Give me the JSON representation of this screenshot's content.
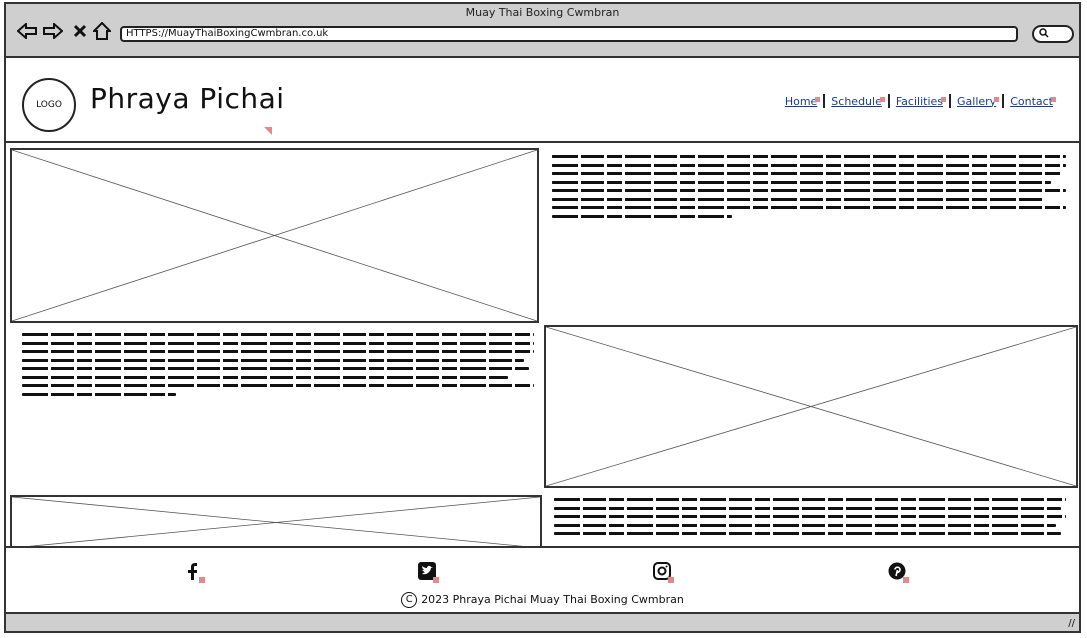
{
  "window": {
    "title": "Muay Thai Boxing Cwmbran"
  },
  "browser": {
    "url": "HTTPS://MuayThaiBoxingCwmbran.co.uk",
    "icons": [
      "back-icon",
      "forward-icon",
      "close-icon",
      "home-icon",
      "search-icon"
    ]
  },
  "header": {
    "logo_text": "LOGO",
    "brand": "Phraya Pichai",
    "nav": [
      {
        "label": "Home"
      },
      {
        "label": "Schedule"
      },
      {
        "label": "Facilities"
      },
      {
        "label": "Gallery"
      },
      {
        "label": "Contact"
      }
    ]
  },
  "footer": {
    "social": [
      "facebook-icon",
      "twitter-icon",
      "instagram-icon",
      "pinterest-icon"
    ],
    "copyright": "2023 Phraya Pichai Muay Thai Boxing Cwmbran"
  },
  "colors": {
    "chrome": "#cfcfcf",
    "link": "#1a3d8f",
    "marker": "#e28a8a"
  }
}
